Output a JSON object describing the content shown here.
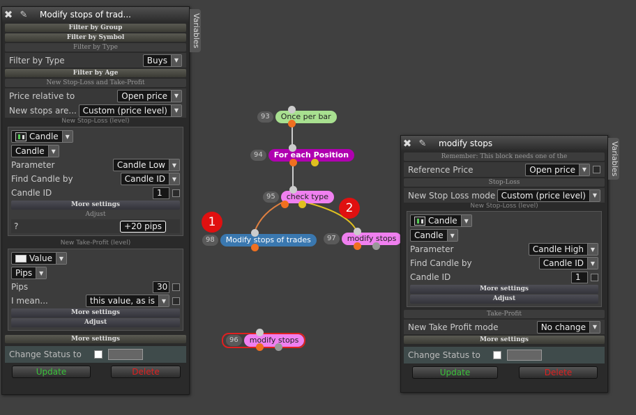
{
  "canvas": {
    "nodes": [
      {
        "id": "93",
        "label": "Once per bar",
        "bg": "#a8e090",
        "fg": "#222222"
      },
      {
        "id": "94",
        "label": "For each Position",
        "bg": "#b000b0",
        "fg": "#ffffff"
      },
      {
        "id": "95",
        "label": "check type",
        "bg": "#f080f0",
        "fg": "#222222"
      },
      {
        "id": "98",
        "label": "Modify stops of trades",
        "bg": "#3a78b0",
        "fg": "#ffffff"
      },
      {
        "id": "97",
        "label": "modify stops",
        "bg": "#f080f0",
        "fg": "#222222"
      },
      {
        "id": "96",
        "label": "modify stops",
        "bg": "#f080f0",
        "fg": "#222222"
      }
    ],
    "badges": [
      "1",
      "2"
    ]
  },
  "left_panel": {
    "title": "Modify stops of trad...",
    "variables_tab": "Variables",
    "filter_group": "Filter by Group",
    "filter_symbol": "Filter by Symbol",
    "filter_type_header": "Filter by Type",
    "filter_type_label": "Filter by Type",
    "filter_type_value": "Buys",
    "filter_age": "Filter by Age",
    "new_sl_tp": "New Stop-Loss and Take-Profit",
    "price_relative_label": "Price relative to",
    "price_relative_value": "Open price",
    "new_stops_label": "New stops are...",
    "new_stops_value": "Custom (price level)",
    "sl_header": "New Stop-Loss (level)",
    "sl_type": "Candle",
    "sl_subtype": "Candle",
    "parameter_label": "Parameter",
    "parameter_value": "Candle Low",
    "find_candle_label": "Find Candle by",
    "find_candle_value": "Candle ID",
    "candle_id_label": "Candle ID",
    "candle_id_value": "1",
    "more_settings_1": "More settings",
    "adjust_header": "Adjust",
    "adjust_label": "?",
    "adjust_value": "+20 pips",
    "tp_header": "New Take-Profit (level)",
    "tp_type": "Value",
    "tp_subtype": "Pips",
    "pips_label": "Pips",
    "pips_value": "30",
    "mean_label": "I mean...",
    "mean_value": "this value, as is",
    "more_settings_2": "More settings",
    "adjust_2": "Adjust",
    "more_settings_3": "More settings",
    "change_status": "Change Status to",
    "update": "Update",
    "delete": "Delete"
  },
  "right_panel": {
    "title": "modify stops",
    "variables_tab": "Variables",
    "remember": "Remember: This block needs one of the",
    "ref_price_label": "Reference Price",
    "ref_price_value": "Open price",
    "stop_loss_header": "Stop-Loss",
    "sl_mode_label": "New Stop Loss mode",
    "sl_mode_value": "Custom (price level)",
    "sl_level_header": "New Stop-Loss (level)",
    "sl_type": "Candle",
    "sl_subtype": "Candle",
    "parameter_label": "Parameter",
    "parameter_value": "Candle High",
    "find_candle_label": "Find Candle by",
    "find_candle_value": "Candle ID",
    "candle_id_label": "Candle ID",
    "candle_id_value": "1",
    "more_settings_1": "More settings",
    "adjust": "Adjust",
    "take_profit_header": "Take-Profit",
    "tp_mode_label": "New Take Profit mode",
    "tp_mode_value": "No change",
    "more_settings_2": "More settings",
    "change_status": "Change Status to",
    "update": "Update",
    "delete": "Delete"
  },
  "colors": {
    "update": "#3ac33a",
    "delete": "#e02020"
  }
}
